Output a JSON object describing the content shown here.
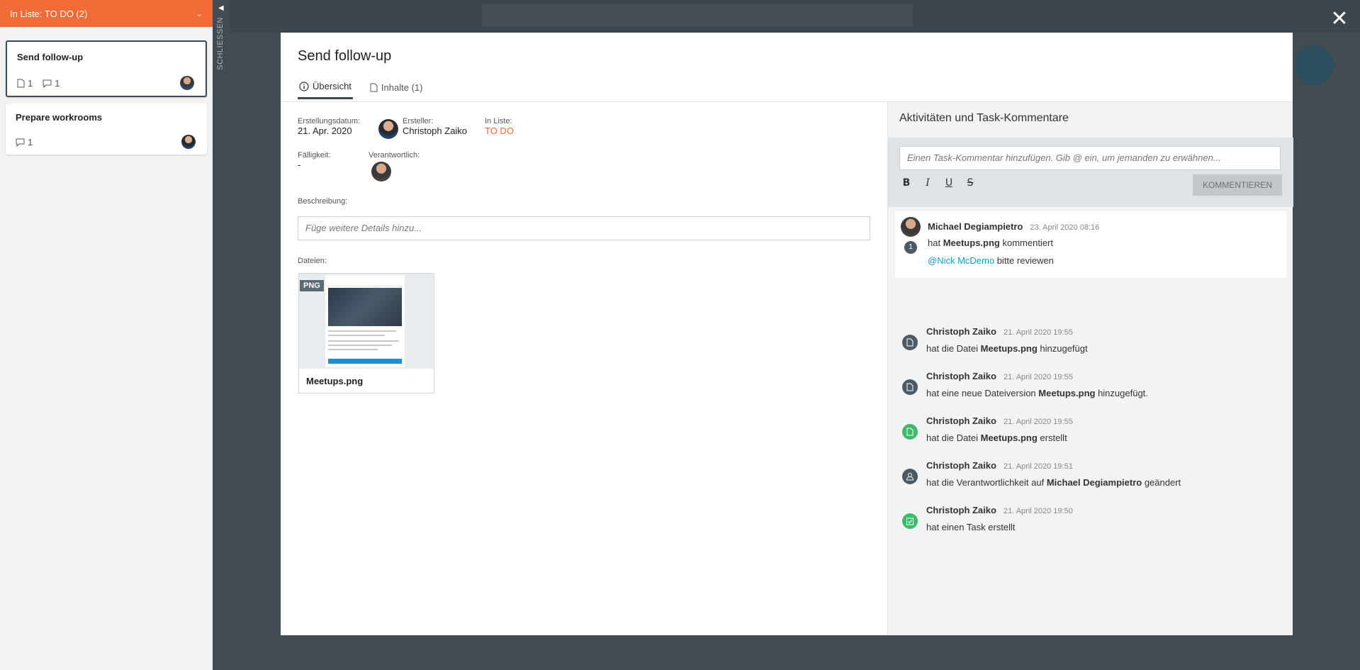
{
  "left_panel": {
    "header": "In Liste:  TO DO (2)",
    "close_label": "SCHLIESSEN",
    "cards": [
      {
        "title": "Send follow-up",
        "files": "1",
        "comments": "1"
      },
      {
        "title": "Prepare workrooms",
        "comments": "1"
      }
    ]
  },
  "modal": {
    "title": "Send follow-up",
    "tabs": [
      {
        "label": "Übersicht",
        "icon": "info-icon"
      },
      {
        "label": "Inhalte (1)",
        "icon": "document-icon"
      }
    ],
    "creation_date_label": "Erstellungsdatum:",
    "creation_date": "21. Apr. 2020",
    "creator_label": "Ersteller:",
    "creator": "Christoph Zaiko",
    "in_list_label": "In Liste:",
    "in_list": "TO DO",
    "due_label": "Fälligkeit:",
    "due": "-",
    "responsible_label": "Verantwortlich:",
    "description_label": "Beschreibung:",
    "description_placeholder": "Füge weitere Details hinzu...",
    "files_label": "Dateien:",
    "file": {
      "badge": "PNG",
      "name": "Meetups.png"
    }
  },
  "activities": {
    "title": "Aktivitäten und Task-Kommentare",
    "comment_placeholder": "Einen Task-Kommentar hinzufügen. Gib @ ein, um jemanden zu erwähnen...",
    "format_buttons": [
      "B",
      "I",
      "U",
      "S"
    ],
    "submit_label": "KOMMENTIEREN",
    "comment": {
      "author": "Michael Degiampietro",
      "time": "23. April 2020 08:16",
      "count": "1",
      "line_pre": "hat ",
      "line_bold": "Meetups.png",
      "line_post": " kommentiert",
      "mention": "@Nick McDemo",
      "mention_text": " bitte reviewen"
    },
    "items": [
      {
        "author": "Christoph Zaiko",
        "time": "21. April 2020 19:55",
        "pre": "hat die Datei ",
        "bold": "Meetups.png",
        "post": " hinzugefügt",
        "icon": "document-icon"
      },
      {
        "author": "Christoph Zaiko",
        "time": "21. April 2020 19:55",
        "pre": "hat eine neue Dateiversion ",
        "bold": "Meetups.png",
        "post": " hinzugefügt.",
        "icon": "document-icon"
      },
      {
        "author": "Christoph Zaiko",
        "time": "21. April 2020 19:55",
        "pre": "hat die Datei ",
        "bold": "Meetups.png",
        "post": " erstellt",
        "icon": "document-created-icon"
      },
      {
        "author": "Christoph Zaiko",
        "time": "21. April 2020 19:51",
        "pre": "hat die Verantwortlichkeit auf ",
        "bold": "Michael Degiampietro",
        "post": " geändert",
        "icon": "user-change-icon"
      },
      {
        "author": "Christoph Zaiko",
        "time": "21. April 2020 19:50",
        "pre": "hat einen Task erstellt",
        "bold": "",
        "post": "",
        "icon": "task-created-icon"
      }
    ]
  },
  "colors": {
    "accent": "#f26a35",
    "mention": "#1a9bc1",
    "green": "#3dba6a",
    "dark": "#414b51"
  }
}
